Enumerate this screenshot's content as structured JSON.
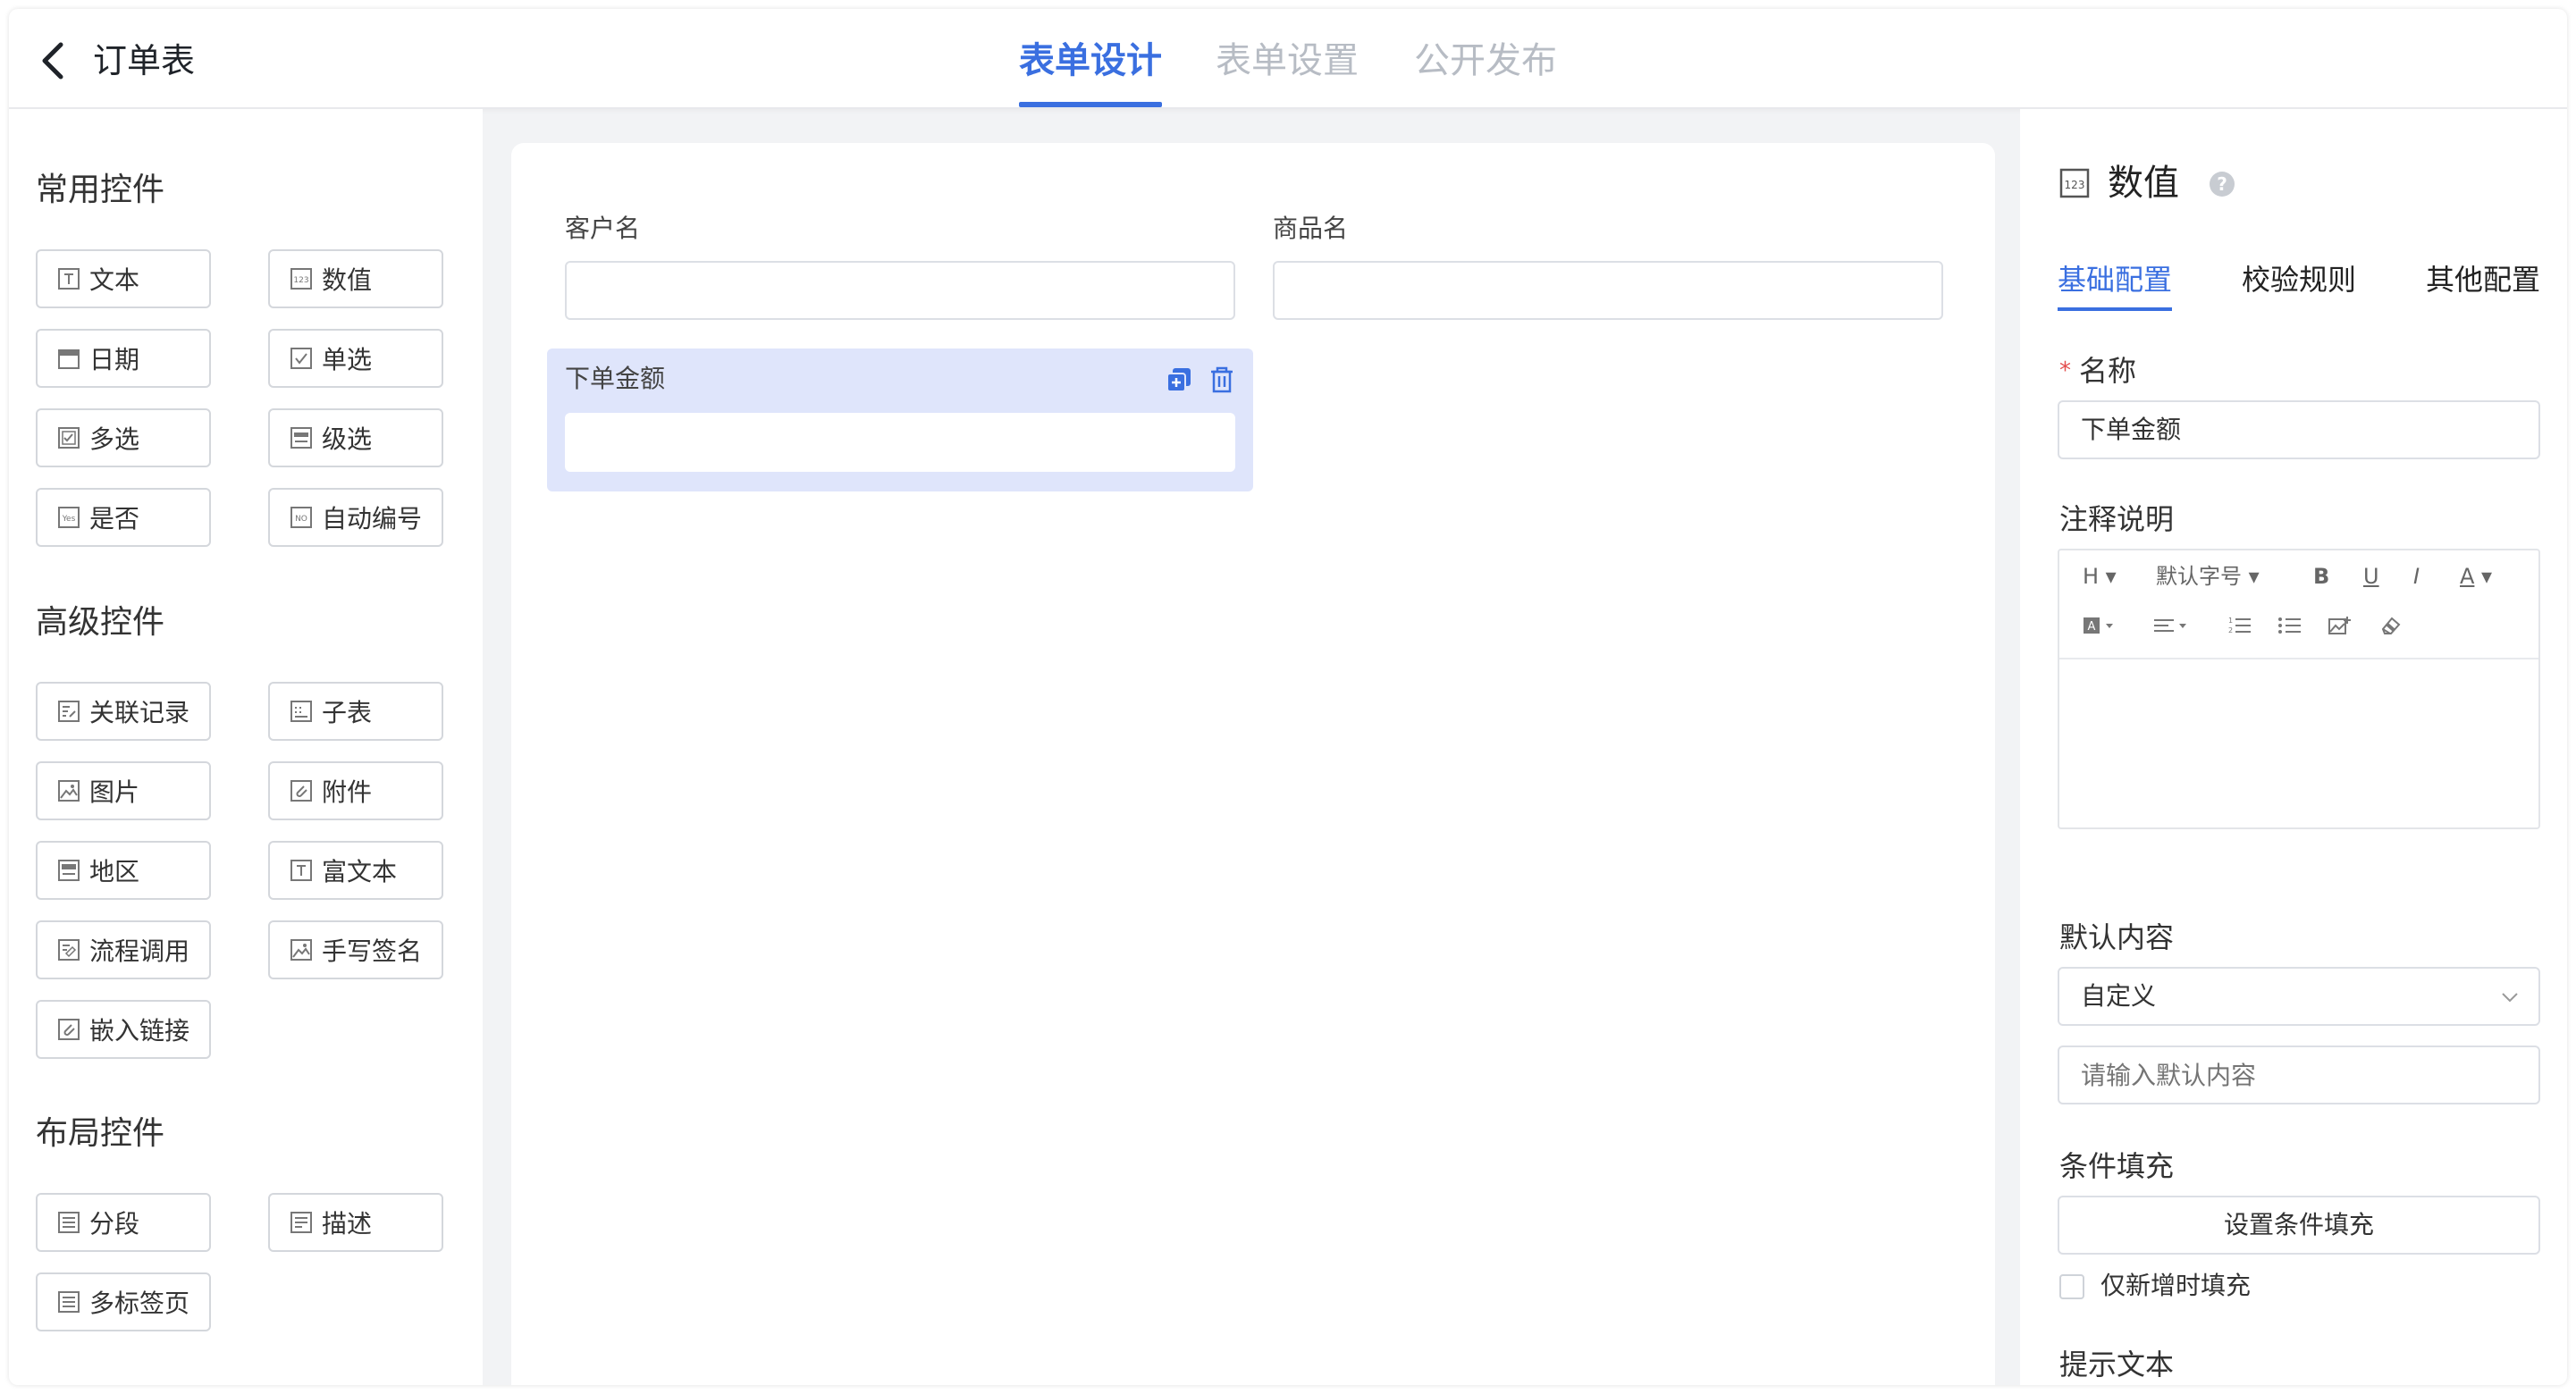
{
  "header": {
    "title": "订单表",
    "tabs": [
      {
        "label": "表单设计",
        "active": true
      },
      {
        "label": "表单设置",
        "active": false
      },
      {
        "label": "公开发布",
        "active": false
      }
    ],
    "accent_color": "#3a6fe0"
  },
  "palette": {
    "common": {
      "title": "常用控件",
      "items": [
        {
          "label": "文本",
          "icon": "text-icon"
        },
        {
          "label": "数值",
          "icon": "number-icon"
        },
        {
          "label": "日期",
          "icon": "calendar-icon"
        },
        {
          "label": "单选",
          "icon": "radio-check-icon"
        },
        {
          "label": "多选",
          "icon": "checkbox-icon"
        },
        {
          "label": "级选",
          "icon": "cascade-icon"
        },
        {
          "label": "是否",
          "icon": "yes-no-icon"
        },
        {
          "label": "自动编号",
          "icon": "auto-number-icon"
        }
      ]
    },
    "advanced": {
      "title": "高级控件",
      "items": [
        {
          "label": "关联记录",
          "icon": "link-record-icon"
        },
        {
          "label": "子表",
          "icon": "subtable-icon"
        },
        {
          "label": "图片",
          "icon": "image-icon"
        },
        {
          "label": "附件",
          "icon": "attachment-icon"
        },
        {
          "label": "地区",
          "icon": "region-icon"
        },
        {
          "label": "富文本",
          "icon": "rich-text-icon"
        },
        {
          "label": "流程调用",
          "icon": "process-call-icon"
        },
        {
          "label": "手写签名",
          "icon": "signature-icon"
        },
        {
          "label": "嵌入链接",
          "icon": "embed-link-icon"
        }
      ]
    },
    "layout": {
      "title": "布局控件",
      "items": [
        {
          "label": "分段",
          "icon": "section-icon"
        },
        {
          "label": "描述",
          "icon": "description-icon"
        },
        {
          "label": "多标签页",
          "icon": "tabs-icon"
        }
      ]
    }
  },
  "canvas": {
    "fields": [
      {
        "label": "客户名",
        "value": ""
      },
      {
        "label": "商品名",
        "value": ""
      }
    ],
    "selected_field": {
      "label": "下单金额",
      "value": ""
    }
  },
  "properties": {
    "title": "数值",
    "tabs": [
      {
        "label": "基础配置",
        "active": true
      },
      {
        "label": "校验规则",
        "active": false
      },
      {
        "label": "其他配置",
        "active": false
      }
    ],
    "name_label": "名称",
    "required_mark": "*",
    "name_value": "下单金额",
    "note_label": "注释说明",
    "toolbar": {
      "heading": "H",
      "font_size": "默认字号",
      "bold": "B",
      "underline": "U",
      "italic": "I",
      "font_color": "A"
    },
    "default_label": "默认内容",
    "default_select": "自定义",
    "default_placeholder": "请输入默认内容",
    "condition_label": "条件填充",
    "condition_button": "设置条件填充",
    "only_new_label": "仅新增时填充",
    "only_new_checked": false,
    "hint_label": "提示文本"
  }
}
